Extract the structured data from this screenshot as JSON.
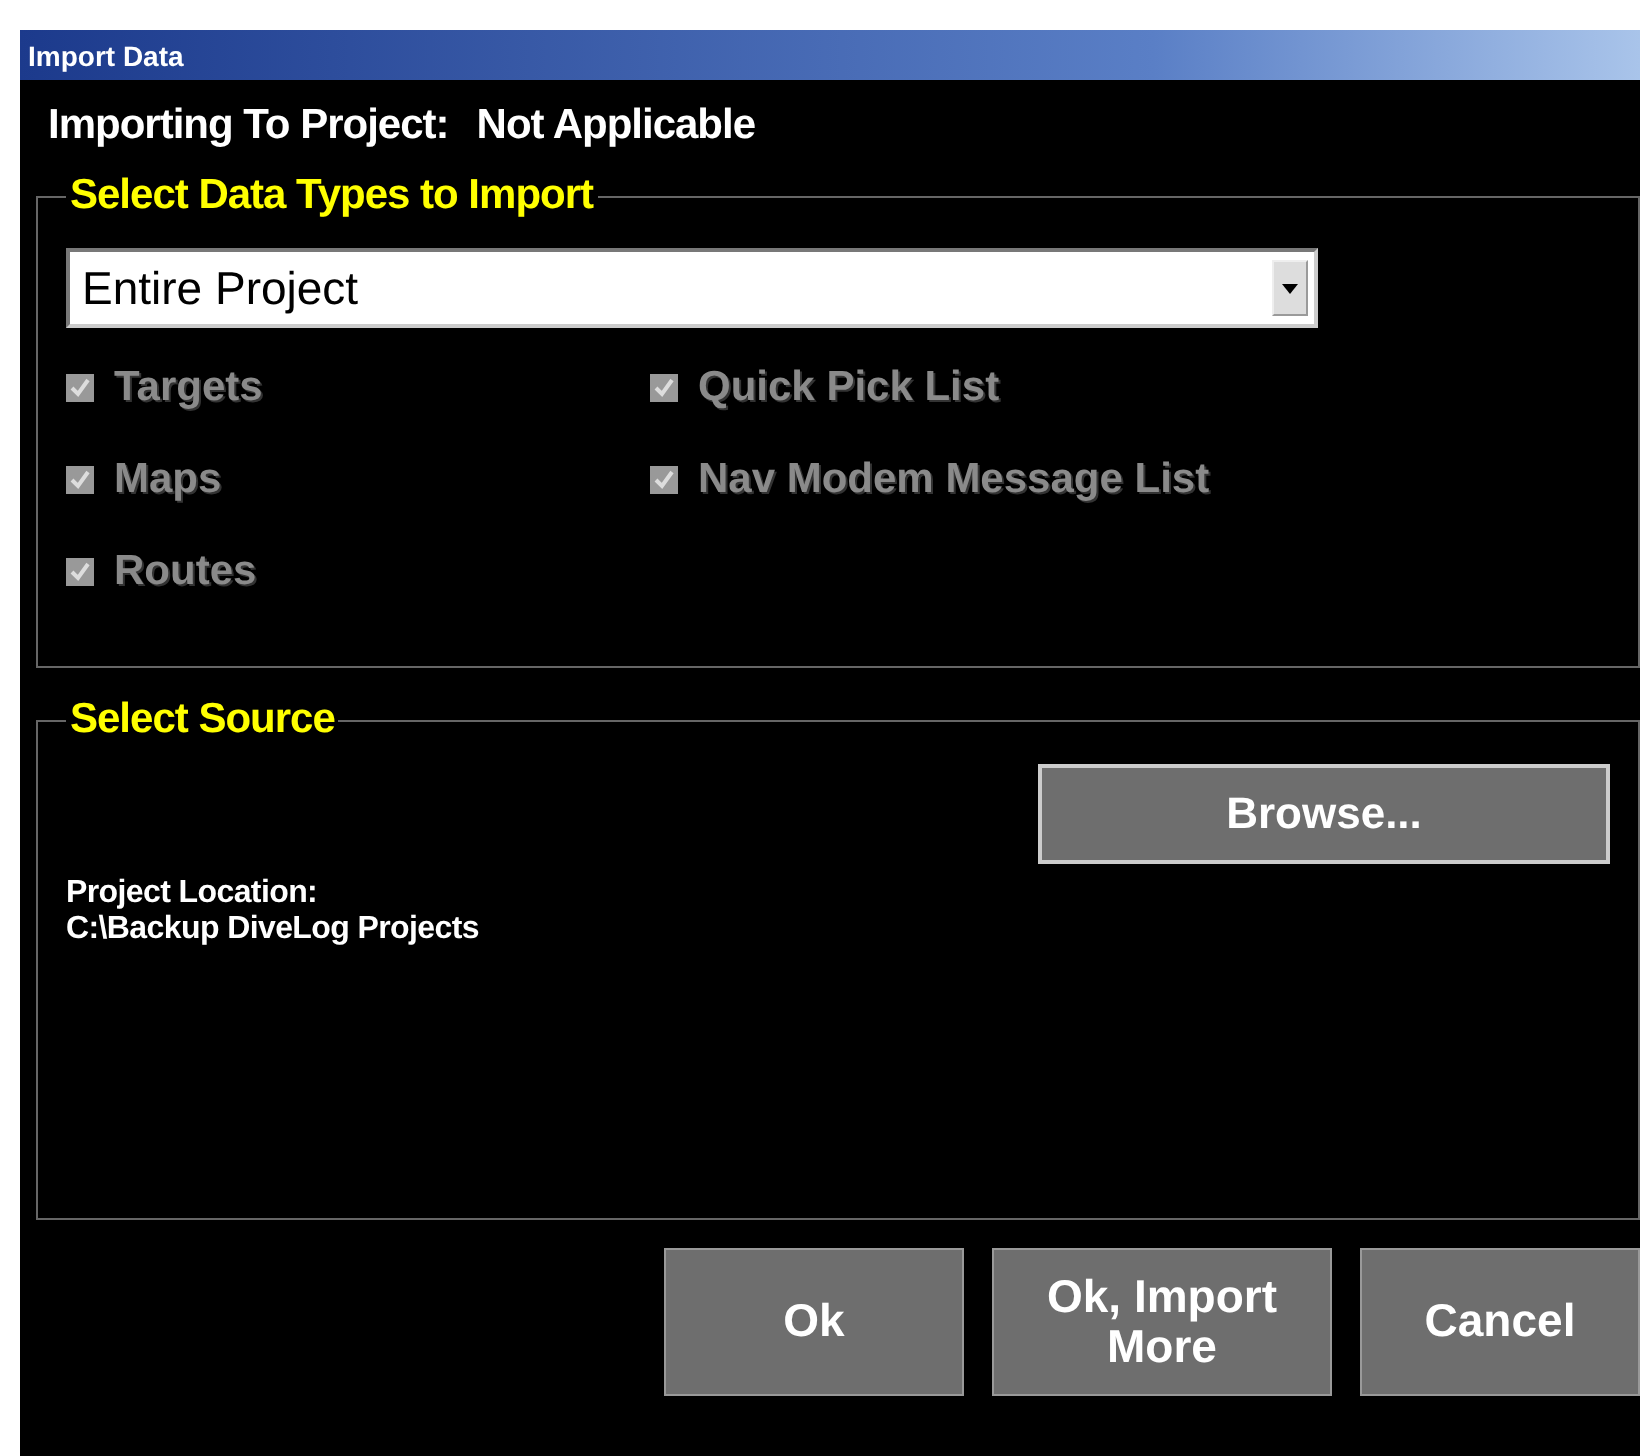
{
  "window": {
    "title": "Import Data"
  },
  "project": {
    "label": "Importing To Project:",
    "value": "Not Applicable"
  },
  "data_types": {
    "legend": "Select Data Types to Import",
    "dropdown": {
      "value": "Entire Project"
    },
    "options": [
      {
        "label": "Targets",
        "checked": true,
        "disabled": true
      },
      {
        "label": "Quick Pick List",
        "checked": true,
        "disabled": true
      },
      {
        "label": "Maps",
        "checked": true,
        "disabled": true
      },
      {
        "label": "Nav Modem Message List",
        "checked": true,
        "disabled": true
      },
      {
        "label": "Routes",
        "checked": true,
        "disabled": true
      }
    ]
  },
  "source": {
    "legend": "Select Source",
    "browse": "Browse...",
    "location_label": "Project Location:",
    "location": "C:\\Backup DiveLog Projects"
  },
  "buttons": [
    "Ok",
    "Ok, Import More",
    "Cancel"
  ]
}
